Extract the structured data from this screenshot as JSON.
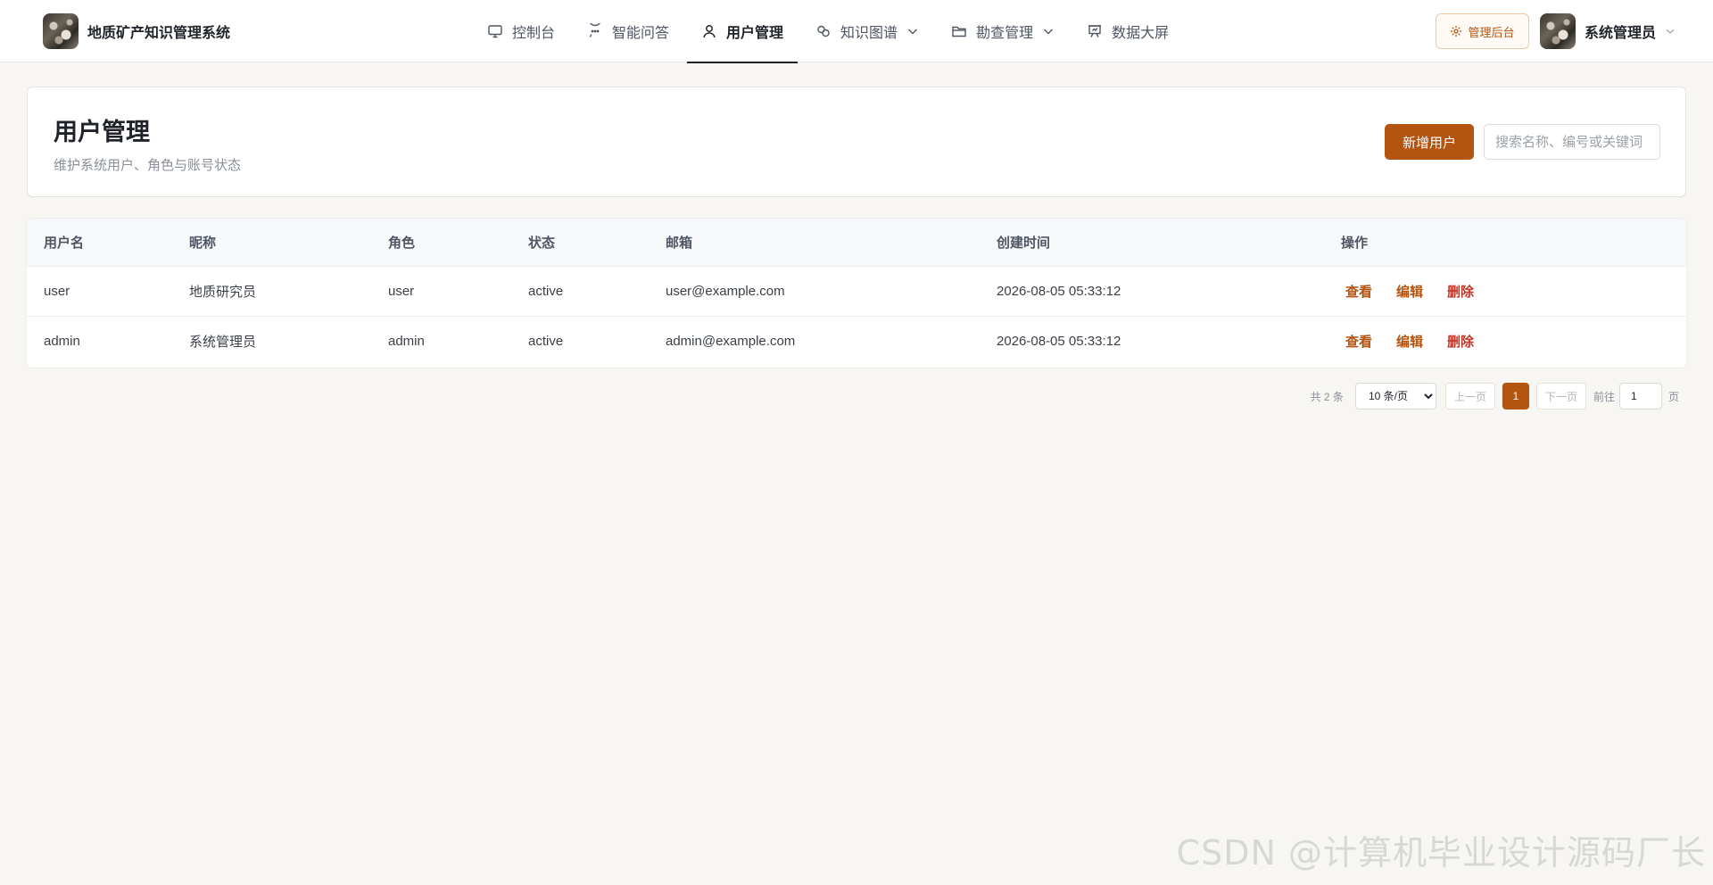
{
  "app": {
    "title": "地质矿产知识管理系统"
  },
  "nav": [
    {
      "label": "控制台",
      "icon": "monitor-icon"
    },
    {
      "label": "智能问答",
      "icon": "chat-icon"
    },
    {
      "label": "用户管理",
      "icon": "user-icon",
      "active": true
    },
    {
      "label": "知识图谱",
      "icon": "graph-icon",
      "dropdown": true
    },
    {
      "label": "勘查管理",
      "icon": "folder-icon",
      "dropdown": true
    },
    {
      "label": "数据大屏",
      "icon": "presentation-icon"
    }
  ],
  "header": {
    "admin_button": "管理后台",
    "user_name": "系统管理员"
  },
  "page": {
    "title": "用户管理",
    "subtitle": "维护系统用户、角色与账号状态",
    "add_button": "新增用户",
    "search_placeholder": "搜索名称、编号或关键词"
  },
  "table": {
    "columns": [
      "用户名",
      "昵称",
      "角色",
      "状态",
      "邮箱",
      "创建时间",
      "操作"
    ],
    "rows": [
      {
        "username": "user",
        "nickname": "地质研究员",
        "role": "user",
        "status": "active",
        "email": "user@example.com",
        "created": "2026-08-05 05:33:12"
      },
      {
        "username": "admin",
        "nickname": "系统管理员",
        "role": "admin",
        "status": "active",
        "email": "admin@example.com",
        "created": "2026-08-05 05:33:12"
      }
    ],
    "actions": {
      "view": "查看",
      "edit": "编辑",
      "delete": "删除"
    }
  },
  "pagination": {
    "total": "共 2 条",
    "page_size": "10 条/页",
    "prev": "上一页",
    "current": "1",
    "next": "下一页",
    "goto_label": "前往",
    "goto_value": "1",
    "page_suffix": "页"
  },
  "watermark": "CSDN @计算机毕业设计源码厂长",
  "colors": {
    "accent": "#b35410",
    "danger": "#c0392b",
    "background": "#f7f6f3"
  }
}
